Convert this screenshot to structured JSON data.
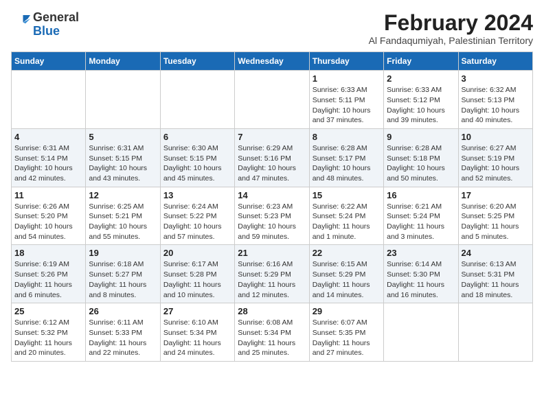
{
  "logo": {
    "general": "General",
    "blue": "Blue"
  },
  "title": {
    "month_year": "February 2024",
    "location": "Al Fandaqumiyah, Palestinian Territory"
  },
  "days_of_week": [
    "Sunday",
    "Monday",
    "Tuesday",
    "Wednesday",
    "Thursday",
    "Friday",
    "Saturday"
  ],
  "weeks": [
    [
      {
        "day": "",
        "info": ""
      },
      {
        "day": "",
        "info": ""
      },
      {
        "day": "",
        "info": ""
      },
      {
        "day": "",
        "info": ""
      },
      {
        "day": "1",
        "info": "Sunrise: 6:33 AM\nSunset: 5:11 PM\nDaylight: 10 hours\nand 37 minutes."
      },
      {
        "day": "2",
        "info": "Sunrise: 6:33 AM\nSunset: 5:12 PM\nDaylight: 10 hours\nand 39 minutes."
      },
      {
        "day": "3",
        "info": "Sunrise: 6:32 AM\nSunset: 5:13 PM\nDaylight: 10 hours\nand 40 minutes."
      }
    ],
    [
      {
        "day": "4",
        "info": "Sunrise: 6:31 AM\nSunset: 5:14 PM\nDaylight: 10 hours\nand 42 minutes."
      },
      {
        "day": "5",
        "info": "Sunrise: 6:31 AM\nSunset: 5:15 PM\nDaylight: 10 hours\nand 43 minutes."
      },
      {
        "day": "6",
        "info": "Sunrise: 6:30 AM\nSunset: 5:15 PM\nDaylight: 10 hours\nand 45 minutes."
      },
      {
        "day": "7",
        "info": "Sunrise: 6:29 AM\nSunset: 5:16 PM\nDaylight: 10 hours\nand 47 minutes."
      },
      {
        "day": "8",
        "info": "Sunrise: 6:28 AM\nSunset: 5:17 PM\nDaylight: 10 hours\nand 48 minutes."
      },
      {
        "day": "9",
        "info": "Sunrise: 6:28 AM\nSunset: 5:18 PM\nDaylight: 10 hours\nand 50 minutes."
      },
      {
        "day": "10",
        "info": "Sunrise: 6:27 AM\nSunset: 5:19 PM\nDaylight: 10 hours\nand 52 minutes."
      }
    ],
    [
      {
        "day": "11",
        "info": "Sunrise: 6:26 AM\nSunset: 5:20 PM\nDaylight: 10 hours\nand 54 minutes."
      },
      {
        "day": "12",
        "info": "Sunrise: 6:25 AM\nSunset: 5:21 PM\nDaylight: 10 hours\nand 55 minutes."
      },
      {
        "day": "13",
        "info": "Sunrise: 6:24 AM\nSunset: 5:22 PM\nDaylight: 10 hours\nand 57 minutes."
      },
      {
        "day": "14",
        "info": "Sunrise: 6:23 AM\nSunset: 5:23 PM\nDaylight: 10 hours\nand 59 minutes."
      },
      {
        "day": "15",
        "info": "Sunrise: 6:22 AM\nSunset: 5:24 PM\nDaylight: 11 hours\nand 1 minute."
      },
      {
        "day": "16",
        "info": "Sunrise: 6:21 AM\nSunset: 5:24 PM\nDaylight: 11 hours\nand 3 minutes."
      },
      {
        "day": "17",
        "info": "Sunrise: 6:20 AM\nSunset: 5:25 PM\nDaylight: 11 hours\nand 5 minutes."
      }
    ],
    [
      {
        "day": "18",
        "info": "Sunrise: 6:19 AM\nSunset: 5:26 PM\nDaylight: 11 hours\nand 6 minutes."
      },
      {
        "day": "19",
        "info": "Sunrise: 6:18 AM\nSunset: 5:27 PM\nDaylight: 11 hours\nand 8 minutes."
      },
      {
        "day": "20",
        "info": "Sunrise: 6:17 AM\nSunset: 5:28 PM\nDaylight: 11 hours\nand 10 minutes."
      },
      {
        "day": "21",
        "info": "Sunrise: 6:16 AM\nSunset: 5:29 PM\nDaylight: 11 hours\nand 12 minutes."
      },
      {
        "day": "22",
        "info": "Sunrise: 6:15 AM\nSunset: 5:29 PM\nDaylight: 11 hours\nand 14 minutes."
      },
      {
        "day": "23",
        "info": "Sunrise: 6:14 AM\nSunset: 5:30 PM\nDaylight: 11 hours\nand 16 minutes."
      },
      {
        "day": "24",
        "info": "Sunrise: 6:13 AM\nSunset: 5:31 PM\nDaylight: 11 hours\nand 18 minutes."
      }
    ],
    [
      {
        "day": "25",
        "info": "Sunrise: 6:12 AM\nSunset: 5:32 PM\nDaylight: 11 hours\nand 20 minutes."
      },
      {
        "day": "26",
        "info": "Sunrise: 6:11 AM\nSunset: 5:33 PM\nDaylight: 11 hours\nand 22 minutes."
      },
      {
        "day": "27",
        "info": "Sunrise: 6:10 AM\nSunset: 5:34 PM\nDaylight: 11 hours\nand 24 minutes."
      },
      {
        "day": "28",
        "info": "Sunrise: 6:08 AM\nSunset: 5:34 PM\nDaylight: 11 hours\nand 25 minutes."
      },
      {
        "day": "29",
        "info": "Sunrise: 6:07 AM\nSunset: 5:35 PM\nDaylight: 11 hours\nand 27 minutes."
      },
      {
        "day": "",
        "info": ""
      },
      {
        "day": "",
        "info": ""
      }
    ]
  ]
}
